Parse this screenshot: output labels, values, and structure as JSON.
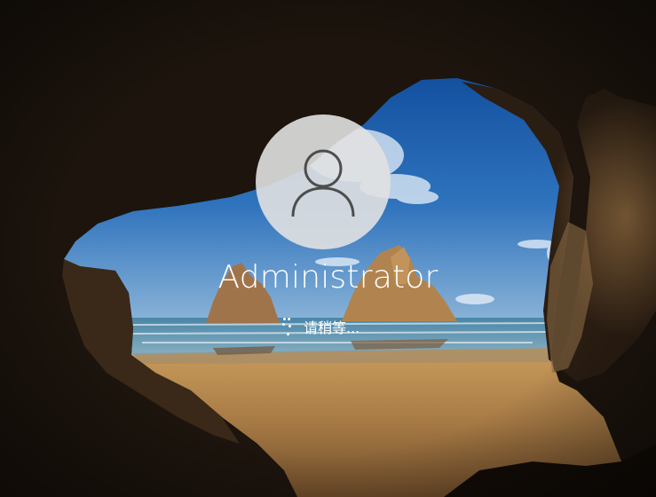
{
  "lock_screen": {
    "user": {
      "name": "Administrator",
      "avatar_icon": "user-silhouette-icon"
    },
    "status": {
      "text": "请稍等...",
      "spinner_icon": "loading-spinner-icon"
    },
    "background": {
      "scene": "sea cave beach wallpaper",
      "sky_color": "#1f5fa8",
      "sea_color": "#3b7fa4",
      "sand_color": "#b8894e",
      "cave_color": "#1a130d"
    }
  }
}
